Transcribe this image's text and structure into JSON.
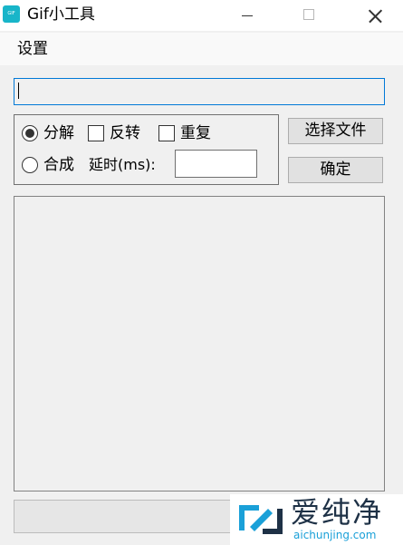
{
  "window": {
    "title": "Gif小工具",
    "app_icon_text": "GIF"
  },
  "menu": {
    "items": [
      {
        "label": "设置"
      }
    ]
  },
  "path_input": {
    "value": ""
  },
  "options": {
    "decompose_label": "分解",
    "reverse_label": "反转",
    "repeat_label": "重复",
    "compose_label": "合成",
    "delay_label": "延时(ms):",
    "delay_value": "",
    "selected_mode": "decompose"
  },
  "buttons": {
    "select_file": "选择文件",
    "confirm": "确定"
  },
  "watermark": {
    "brand": "爱纯净",
    "url": "aichunjing.com"
  },
  "colors": {
    "accent": "#0078d7",
    "app_icon": "#18b5c9",
    "watermark_text": "#1e3146",
    "watermark_url": "#1aa0d8"
  }
}
